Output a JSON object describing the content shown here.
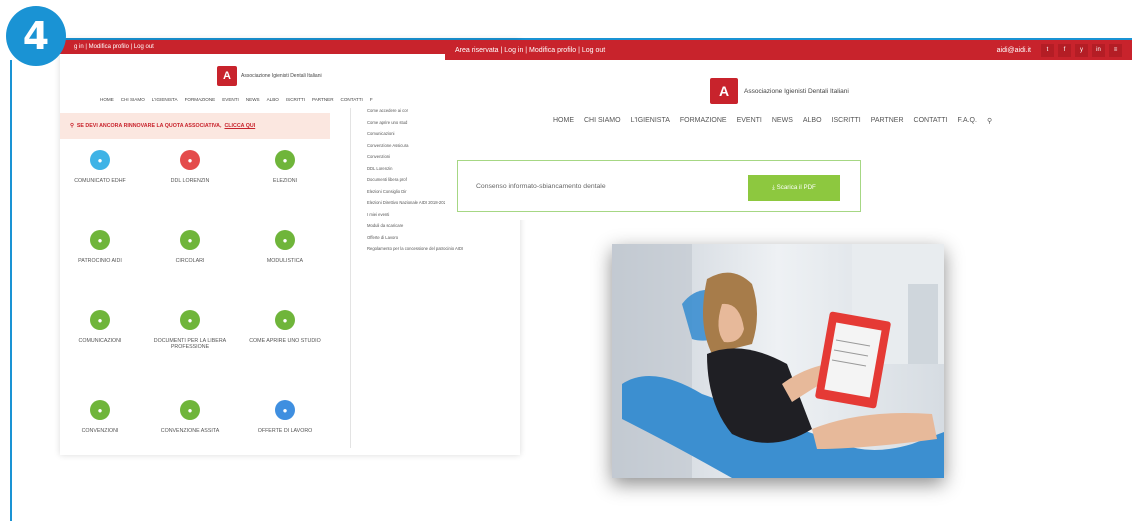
{
  "badge": {
    "step": "4"
  },
  "left_shot": {
    "topbar": "g in  |  Modifica profilo  |  Log out",
    "logo_text": "Associazione Igienisti Dentali Italiani",
    "logo_mark": "AIDI",
    "nav": [
      "HOME",
      "CHI SIAMO",
      "L'IGIENISTA",
      "FORMAZIONE",
      "EVENTI",
      "NEWS",
      "ALBO",
      "ISCRITTI",
      "PARTNER",
      "CONTATTI",
      "F"
    ],
    "alert": {
      "text": "SE DEVI ANCORA RINNOVARE LA QUOTA ASSOCIATIVA,",
      "link": "CLICCA QUI"
    },
    "tiles": [
      {
        "label": "COMUNICATO EDHF",
        "color": "#3fb3e6",
        "icon": "megaphone-icon"
      },
      {
        "label": "DDL LORENZIN",
        "color": "#e44b4b",
        "icon": "document-icon"
      },
      {
        "label": "ELEZIONI",
        "color": "#6fb53a",
        "icon": "ballot-icon"
      },
      {
        "label": "PATROCINIO AIDI",
        "color": "#6fb53a",
        "icon": "badge-icon"
      },
      {
        "label": "CIRCOLARI",
        "color": "#6fb53a",
        "icon": "list-icon"
      },
      {
        "label": "MODULISTICA",
        "color": "#6fb53a",
        "icon": "download-icon"
      },
      {
        "label": "COMUNICAZIONI",
        "color": "#6fb53a",
        "icon": "chat-icon"
      },
      {
        "label": "DOCUMENTI PER LA LIBERA PROFESSIONE",
        "color": "#6fb53a",
        "icon": "folder-icon"
      },
      {
        "label": "COME APRIRE UNO STUDIO",
        "color": "#6fb53a",
        "icon": "question-icon"
      },
      {
        "label": "CONVENZIONI",
        "color": "#6fb53a",
        "icon": "link-icon"
      },
      {
        "label": "CONVENZIONE ASSITA",
        "color": "#6fb53a",
        "icon": "shield-icon"
      },
      {
        "label": "OFFERTE DI LAVORO",
        "color": "#3f8fe0",
        "icon": "briefcase-icon"
      }
    ],
    "side_links": [
      "Come accedere ai cor",
      "Come aprire uno stud",
      "Comunicazioni",
      "Convenzione Assicura",
      "Convenzioni",
      "DDL Lorenzin",
      "Documenti libera prof",
      "Elezioni Consiglio Dir",
      "Elezioni Direttivo Nazionale AIDI 2018-2021",
      "I miei eventi",
      "Moduli da scaricare",
      "Offerte di Lavoro",
      "Regolamento per la concessione del patrocinio AIDI"
    ]
  },
  "right_shot": {
    "topbar_left": "Area riservata | Log in  |  Modifica profilo  |  Log out",
    "topbar_email": "aidi@aidi.it",
    "social": [
      "twitter-icon",
      "facebook-icon",
      "youtube-icon",
      "linkedin-icon",
      "menu-icon"
    ],
    "social_glyphs": [
      "t",
      "f",
      "y",
      "in",
      "≡"
    ],
    "logo_text": "Associazione Igienisti Dentali Italiani",
    "logo_mark": "AIDI",
    "nav": [
      "HOME",
      "CHI SIAMO",
      "L'IGIENISTA",
      "FORMAZIONE",
      "EVENTI",
      "NEWS",
      "ALBO",
      "ISCRITTI",
      "PARTNER",
      "CONTATTI",
      "F.A.Q."
    ],
    "card_text": "Consenso informato-sbiancamento dentale",
    "pdf_button": "⤓ Scarica il PDF"
  }
}
